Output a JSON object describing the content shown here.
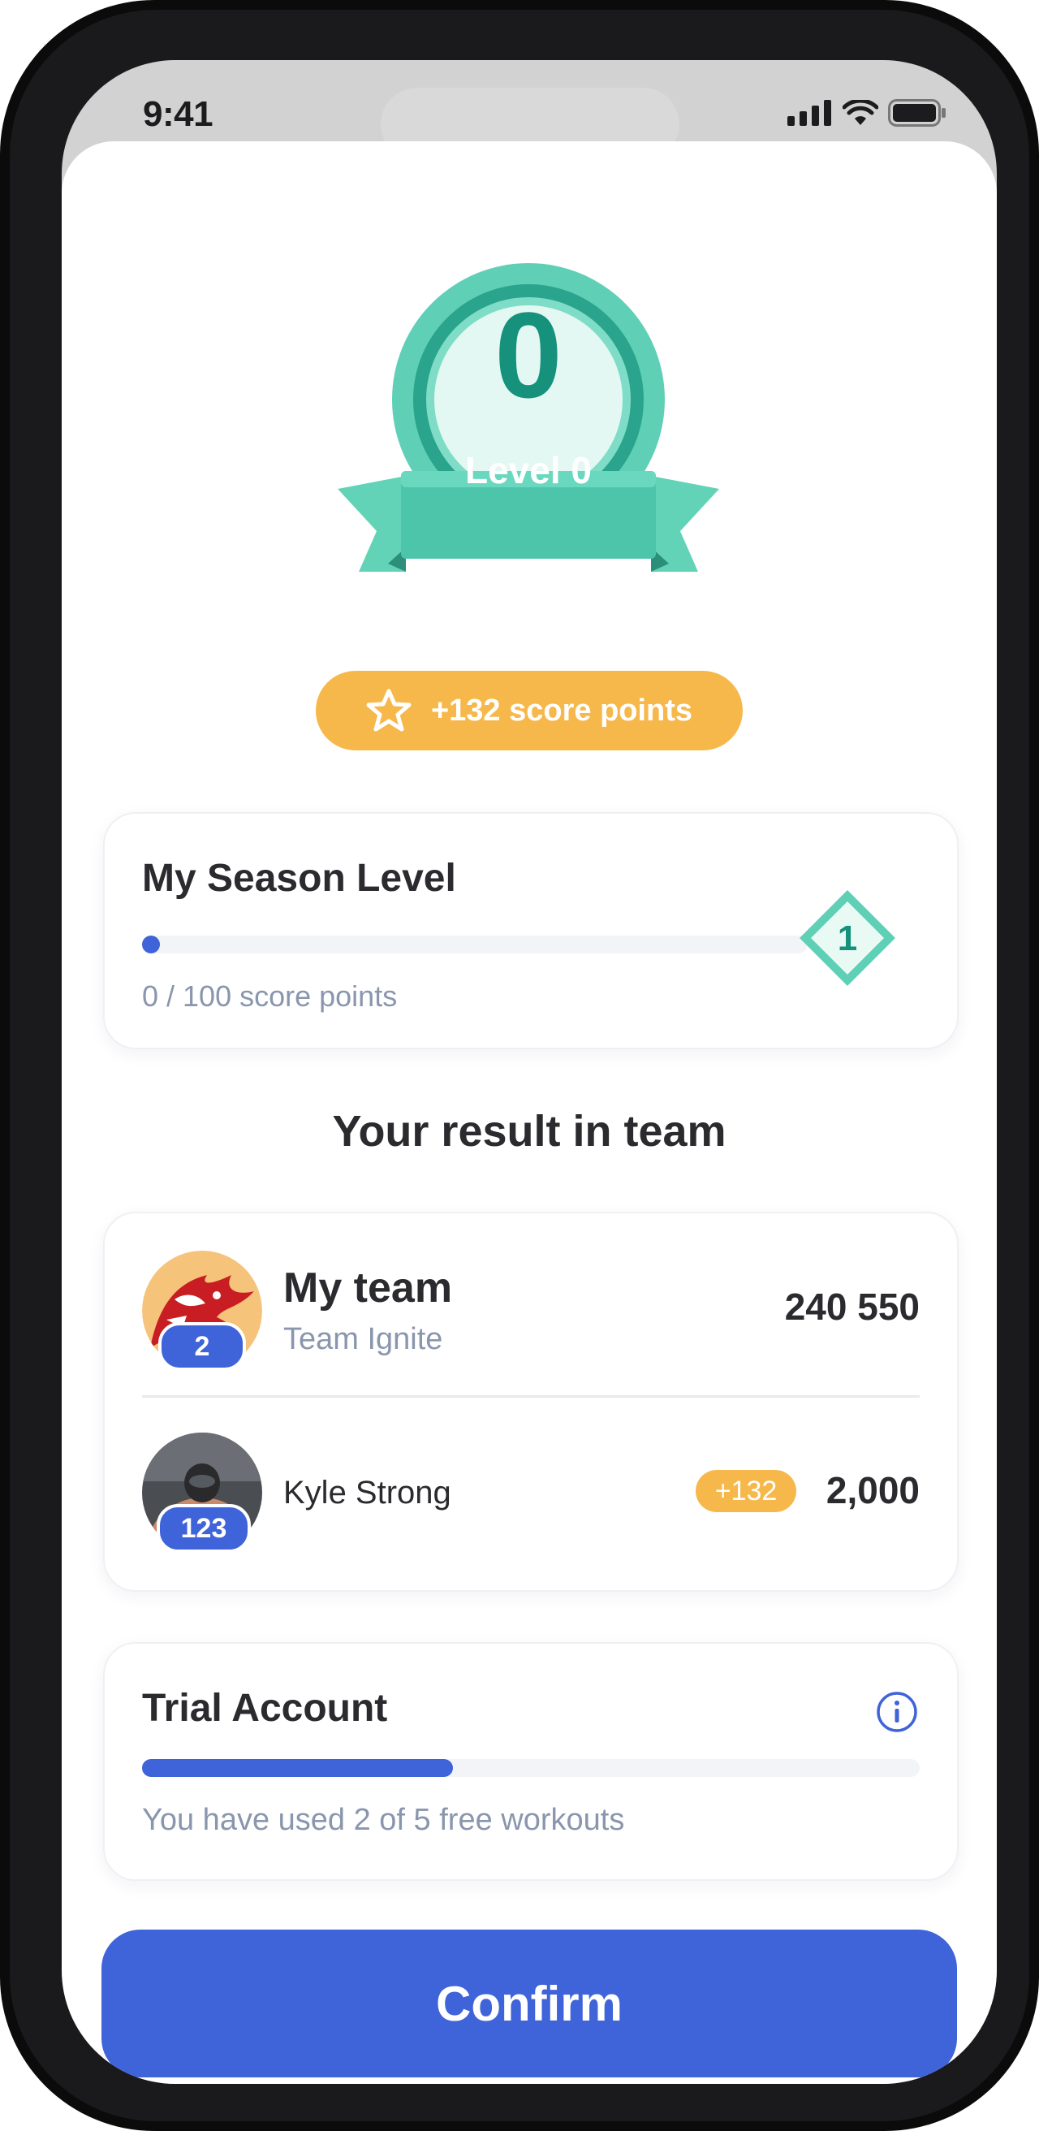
{
  "status_bar": {
    "time": "9:41"
  },
  "badge": {
    "number": "0",
    "level_label": "Level 0"
  },
  "score_pill": {
    "label": "+132 score points"
  },
  "season": {
    "title": "My Season Level",
    "progress_text": "0 / 100 score points",
    "progress_fraction": 0.0,
    "next_level": "1"
  },
  "team_section": {
    "title": "Your result in team",
    "team": {
      "name": "My team",
      "subtitle": "Team Ignite",
      "rank": "2",
      "score": "240 550"
    },
    "player": {
      "name": "Kyle Strong",
      "rank": "123",
      "delta": "+132",
      "score": "2,000"
    }
  },
  "trial": {
    "title": "Trial Account",
    "used": 2,
    "total": 5,
    "progress_fraction": 0.4,
    "text": "You have used 2 of 5 free workouts"
  },
  "confirm_button": {
    "label": "Confirm"
  },
  "colors": {
    "primary": "#3f63d9",
    "gold": "#f7b84b",
    "teal": "#4fcbb1",
    "muted": "#8a96ad"
  }
}
